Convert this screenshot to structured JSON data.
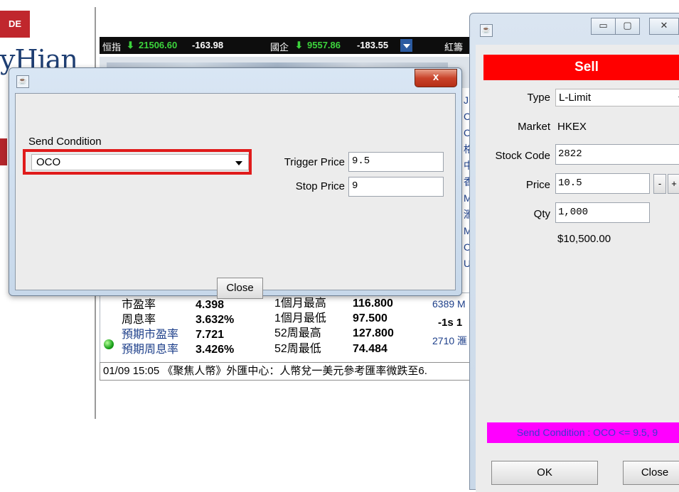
{
  "background": {
    "logo_badge": "DE",
    "logo_text": "yHian",
    "market_bar": {
      "hsi_label": "恒指",
      "hsi_value": "21506.60",
      "hsi_change": "-163.98",
      "hscei_label": "國企",
      "hscei_value": "9557.86",
      "hscei_change": "-183.55",
      "cut_label": "紅籌"
    },
    "stats": {
      "pe_label": "市盈率",
      "pe_value": "4.398",
      "yield_label": "周息率",
      "yield_value": "3.632%",
      "exp_pe_label": "預期市盈率",
      "exp_pe_value": "7.721",
      "exp_yield_label": "預期周息率",
      "exp_yield_value": "3.426%",
      "m1_high_label": "1個月最高",
      "m1_high_value": "116.800",
      "m1_low_label": "1個月最低",
      "m1_low_value": "97.500",
      "w52_high_label": "52周最高",
      "w52_high_value": "127.800",
      "w52_low_label": "52周最低",
      "w52_low_value": "74.484",
      "side_a": "6389 M",
      "side_b": "-1s 1",
      "side_c": "2710 滙"
    },
    "ticker": "01/09 15:05 《聚焦人幣》外匯中心：人幣兌一美元參考匯率微跌至6."
  },
  "condition_dialog": {
    "close_x": "x",
    "send_condition_label": "Send Condition",
    "send_condition_value": "OCO",
    "trigger_price_label": "Trigger Price",
    "trigger_price_value": "9.5",
    "stop_price_label": "Stop Price",
    "stop_price_value": "9",
    "close_label": "Close"
  },
  "sell_window": {
    "title": "Sell",
    "title_color": "#ff0000",
    "type_label": "Type",
    "type_value": "L-Limit",
    "market_label": "Market",
    "market_value": "HKEX",
    "stock_code_label": "Stock Code",
    "stock_code_value": "2822",
    "price_label": "Price",
    "price_value": "10.5",
    "minus": "-",
    "plus": "+",
    "qty_label": "Qty",
    "qty_value": "1,000",
    "amount": "$10,500.00",
    "send_condition_status": "Send Condition : OCO <= 9.5, 9",
    "status_color": "#ff00ff",
    "ok_label": "OK",
    "close_label": "Close"
  }
}
